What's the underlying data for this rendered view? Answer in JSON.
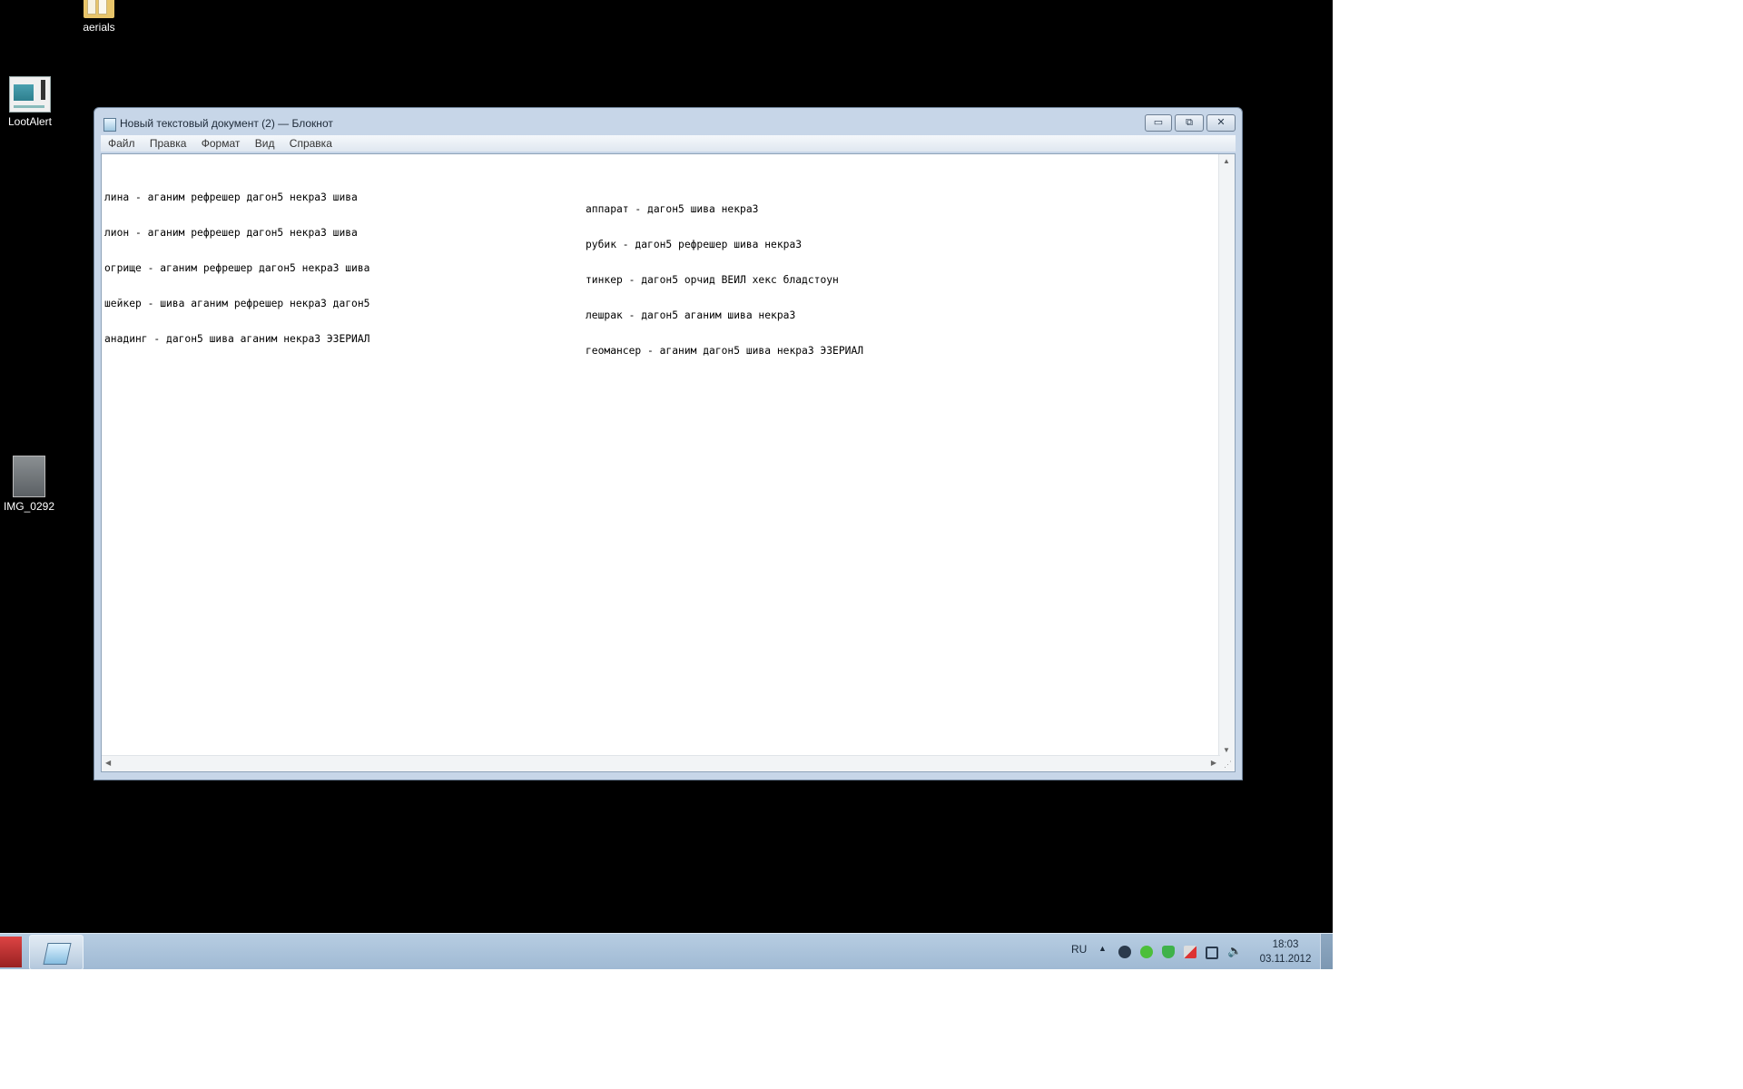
{
  "desktop": {
    "icons": [
      {
        "label": "aerials",
        "icon": "folder-icon"
      },
      {
        "label": "LootAlert",
        "icon": "app-icon"
      },
      {
        "label": "IMG_0292",
        "icon": "image-thumbnail-icon"
      }
    ]
  },
  "window": {
    "title": "Новый текстовый документ (2) — Блокнот",
    "buttons": {
      "minimize": "▭",
      "maximize": "⧉",
      "close": "✕"
    },
    "menu": [
      "Файл",
      "Правка",
      "Формат",
      "Вид",
      "Справка"
    ]
  },
  "document": {
    "lines": [
      {
        "left": "лина - аганим рефрешер дагон5 некра3 шива",
        "right": "аппарат - дагон5 шива некра3"
      },
      {
        "left": "лион - аганим рефрешер дагон5 некра3 шива",
        "right": "рубик - дагон5 рефрешер шива некра3"
      },
      {
        "left": "огрище - аганим рефрешер дагон5 некра3 шива",
        "right": "тинкер - дагон5 орчид ВЕИЛ хекс бладстоун"
      },
      {
        "left": "шейкер - шива аганим рефрешер некра3 дагон5",
        "right": "лешрак - дагон5 аганим шива некра3"
      },
      {
        "left": "анадинг - дагон5 шива аганим некра3 ЭЗЕРИАЛ",
        "right": "геомансер - аганим дагон5 шива некра3 ЭЗЕРИАЛ"
      }
    ]
  },
  "taskbar": {
    "language": "RU",
    "tray_arrow": "▲",
    "clock_time": "18:03",
    "clock_date": "03.11.2012",
    "tray_icons": [
      "steam-icon",
      "settings-cog-icon",
      "shield-check-icon",
      "flag-icon",
      "network-icon",
      "volume-icon"
    ]
  }
}
